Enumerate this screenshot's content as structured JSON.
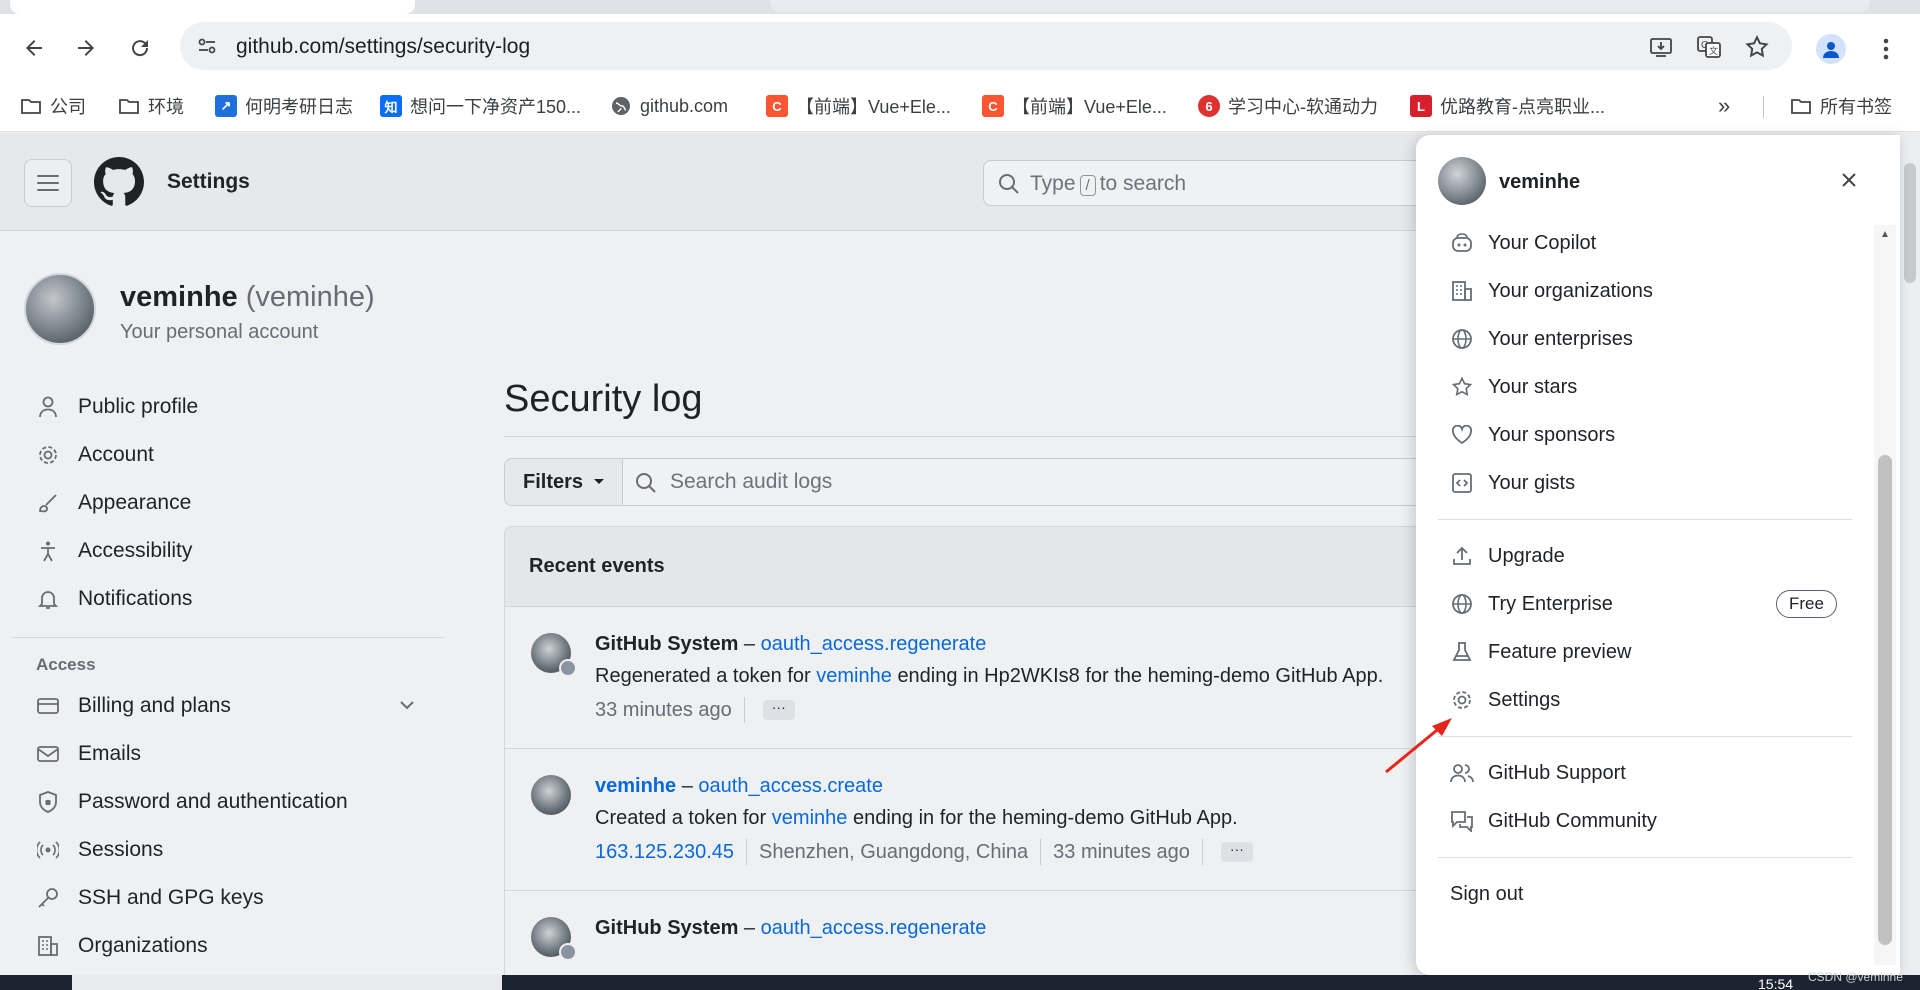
{
  "browser": {
    "url": "github.com/settings/security-log",
    "bookmarks": [
      {
        "label": "公司",
        "icon": "folder-icon"
      },
      {
        "label": "环境",
        "icon": "folder-icon"
      },
      {
        "label": "何明考研日志",
        "icon": "app-icon"
      },
      {
        "label": "想问一下净资产150...",
        "icon": "zhihu-icon"
      },
      {
        "label": "github.com",
        "icon": "globe-icon"
      },
      {
        "label": "【前端】Vue+Ele...",
        "icon": "csdn-icon"
      },
      {
        "label": "【前端】Vue+Ele...",
        "icon": "csdn-icon"
      },
      {
        "label": "学习中心-软通动力",
        "icon": "app-icon"
      },
      {
        "label": "优路教育-点亮职业...",
        "icon": "app-icon"
      }
    ],
    "overflow": "»",
    "all_bookmarks": "所有书签"
  },
  "header": {
    "title": "Settings",
    "search_prefix": "Type",
    "search_key": "/",
    "search_suffix": "to search"
  },
  "account": {
    "name": "veminhe",
    "login": "(veminhe)",
    "subtitle": "Your personal account"
  },
  "sidebar": {
    "items": [
      {
        "label": "Public profile",
        "icon": "person-icon"
      },
      {
        "label": "Account",
        "icon": "gear-icon"
      },
      {
        "label": "Appearance",
        "icon": "paintbrush-icon"
      },
      {
        "label": "Accessibility",
        "icon": "accessibility-icon"
      },
      {
        "label": "Notifications",
        "icon": "bell-icon"
      }
    ],
    "section_access": "Access",
    "access_items": [
      {
        "label": "Billing and plans",
        "icon": "credit-card-icon"
      },
      {
        "label": "Emails",
        "icon": "mail-icon"
      },
      {
        "label": "Password and authentication",
        "icon": "shield-lock-icon"
      },
      {
        "label": "Sessions",
        "icon": "broadcast-icon"
      },
      {
        "label": "SSH and GPG keys",
        "icon": "key-icon"
      },
      {
        "label": "Organizations",
        "icon": "organization-icon"
      }
    ]
  },
  "main": {
    "title": "Security log",
    "filters_label": "Filters",
    "search_placeholder": "Search audit logs",
    "recent_events": "Recent events",
    "events": [
      {
        "actor": "GitHub System",
        "dash": "–",
        "action": "oauth_access.regenerate",
        "desc_prefix": "Regenerated a token for",
        "desc_user": "veminhe",
        "desc_suffix": "ending in Hp2WKIs8 for the heming-demo GitHub App.",
        "time": "33 minutes ago",
        "more": "···"
      },
      {
        "actor": "veminhe",
        "dash": "–",
        "action": "oauth_access.create",
        "desc_prefix": "Created a token for",
        "desc_user": "veminhe",
        "desc_suffix": "ending in for the heming-demo GitHub App.",
        "ip": "163.125.230.45",
        "location": "Shenzhen, Guangdong, China",
        "time": "33 minutes ago",
        "more": "···"
      },
      {
        "actor": "GitHub System",
        "dash": "–",
        "action": "oauth_access.regenerate"
      }
    ]
  },
  "user_menu": {
    "name": "veminhe",
    "group1": [
      {
        "label": "Your Copilot",
        "icon": "copilot-icon"
      },
      {
        "label": "Your organizations",
        "icon": "organization-icon"
      },
      {
        "label": "Your enterprises",
        "icon": "globe-icon"
      },
      {
        "label": "Your stars",
        "icon": "star-icon"
      },
      {
        "label": "Your sponsors",
        "icon": "heart-icon"
      },
      {
        "label": "Your gists",
        "icon": "code-square-icon"
      }
    ],
    "group2": [
      {
        "label": "Upgrade",
        "icon": "upload-icon"
      },
      {
        "label": "Try Enterprise",
        "icon": "globe-icon",
        "badge": "Free"
      },
      {
        "label": "Feature preview",
        "icon": "beaker-icon"
      },
      {
        "label": "Settings",
        "icon": "gear-icon"
      }
    ],
    "group3": [
      {
        "label": "GitHub Support",
        "icon": "people-icon"
      },
      {
        "label": "GitHub Community",
        "icon": "comment-discussion-icon"
      }
    ],
    "sign_out": "Sign out"
  },
  "footer": {
    "watermark": "CSDN @veminhe",
    "clock": "15:54"
  },
  "colors": {
    "link": "#0969da",
    "annotation_arrow": "#e8251c"
  }
}
